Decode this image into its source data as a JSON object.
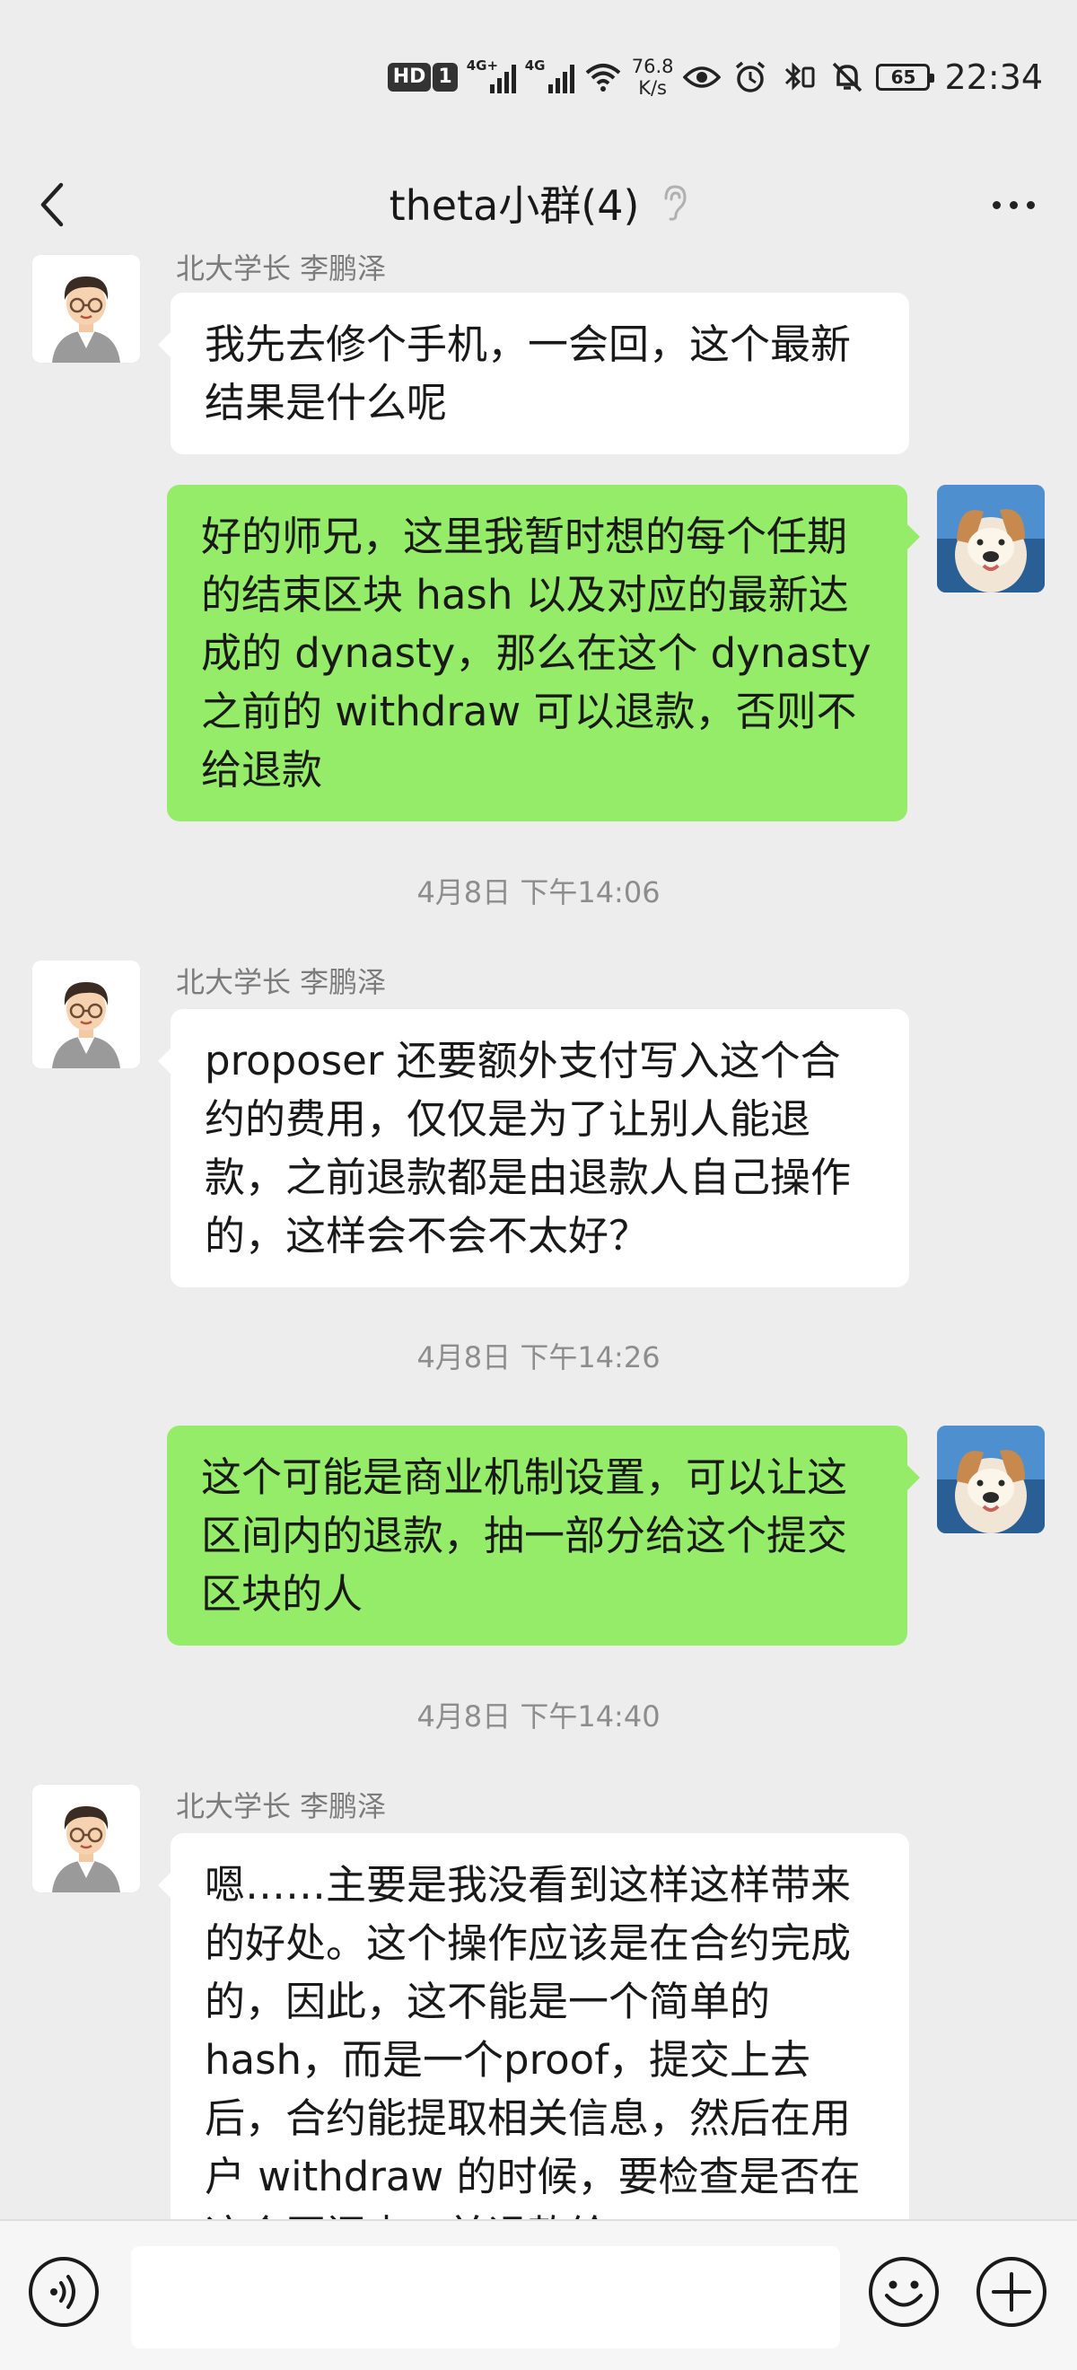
{
  "status_bar": {
    "hd_badge": "HD",
    "sim_badge": "1",
    "signal_1_label": "4G+",
    "signal_2_label": "4G",
    "net_speed_value": "76.8",
    "net_speed_unit": "K/s",
    "battery_level": "65",
    "time": "22:34"
  },
  "nav": {
    "title": "theta小群(4)"
  },
  "messages": [
    {
      "side": "them",
      "sender": "北大学长 李鹏泽",
      "text": "我先去修个手机，一会回，这个最新结果是什么呢"
    },
    {
      "side": "me",
      "text": "好的师兄，这里我暂时想的每个任期的结束区块 hash 以及对应的最新达成的 dynasty，那么在这个 dynasty 之前的 withdraw 可以退款，否则不给退款"
    },
    {
      "timestamp": "4月8日 下午14:06"
    },
    {
      "side": "them",
      "sender": "北大学长 李鹏泽",
      "text": "proposer 还要额外支付写入这个合约的费用，仅仅是为了让别人能退款，之前退款都是由退款人自己操作的，这样会不会不太好？"
    },
    {
      "timestamp": "4月8日 下午14:26"
    },
    {
      "side": "me",
      "text": "这个可能是商业机制设置，可以让这区间内的退款，抽一部分给这个提交区块的人"
    },
    {
      "timestamp": "4月8日 下午14:40"
    },
    {
      "side": "them",
      "sender": "北大学长 李鹏泽",
      "text": "嗯……主要是我没看到这样这样带来的好处。这个操作应该是在合约完成的，因此，这不能是一个简单的hash，而是一个proof，提交上去后，合约能提取相关信息，然后在用户 withdraw 的时候，要检查是否在这个区间内，并退款给"
    }
  ],
  "input": {
    "value": ""
  },
  "colors": {
    "background": "#ededed",
    "bubble_me": "#95ec69",
    "bubble_them": "#ffffff",
    "timestamp_text": "#8d8d8d"
  }
}
